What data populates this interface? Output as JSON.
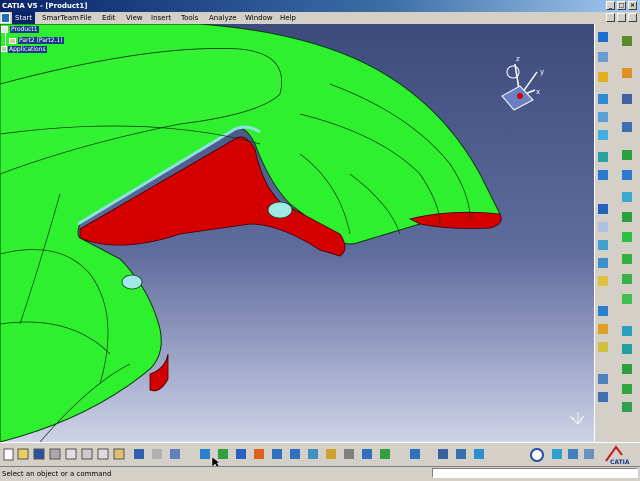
{
  "window": {
    "title": "CATIA V5 - [Product1]"
  },
  "menubar": {
    "items": [
      "Start",
      "SmarTeam",
      "File",
      "Edit",
      "View",
      "Insert",
      "Tools",
      "Analyze",
      "Window",
      "Help"
    ]
  },
  "tree": {
    "root": "Product1",
    "child": "Part2 (Part2.1)",
    "applications": "Applications"
  },
  "compass": {
    "x_label": "x",
    "y_label": "y",
    "z_label": "z"
  },
  "axis_icon": {
    "x_label": "x",
    "y_label": "y"
  },
  "status": {
    "message": "Select an object or a command"
  },
  "logo": {
    "text": "CATIA"
  },
  "colors": {
    "model": "#2ef02e",
    "interior": "#d40000",
    "background_top": "#3d4b7c",
    "background_bottom": "#cfd3e8"
  }
}
